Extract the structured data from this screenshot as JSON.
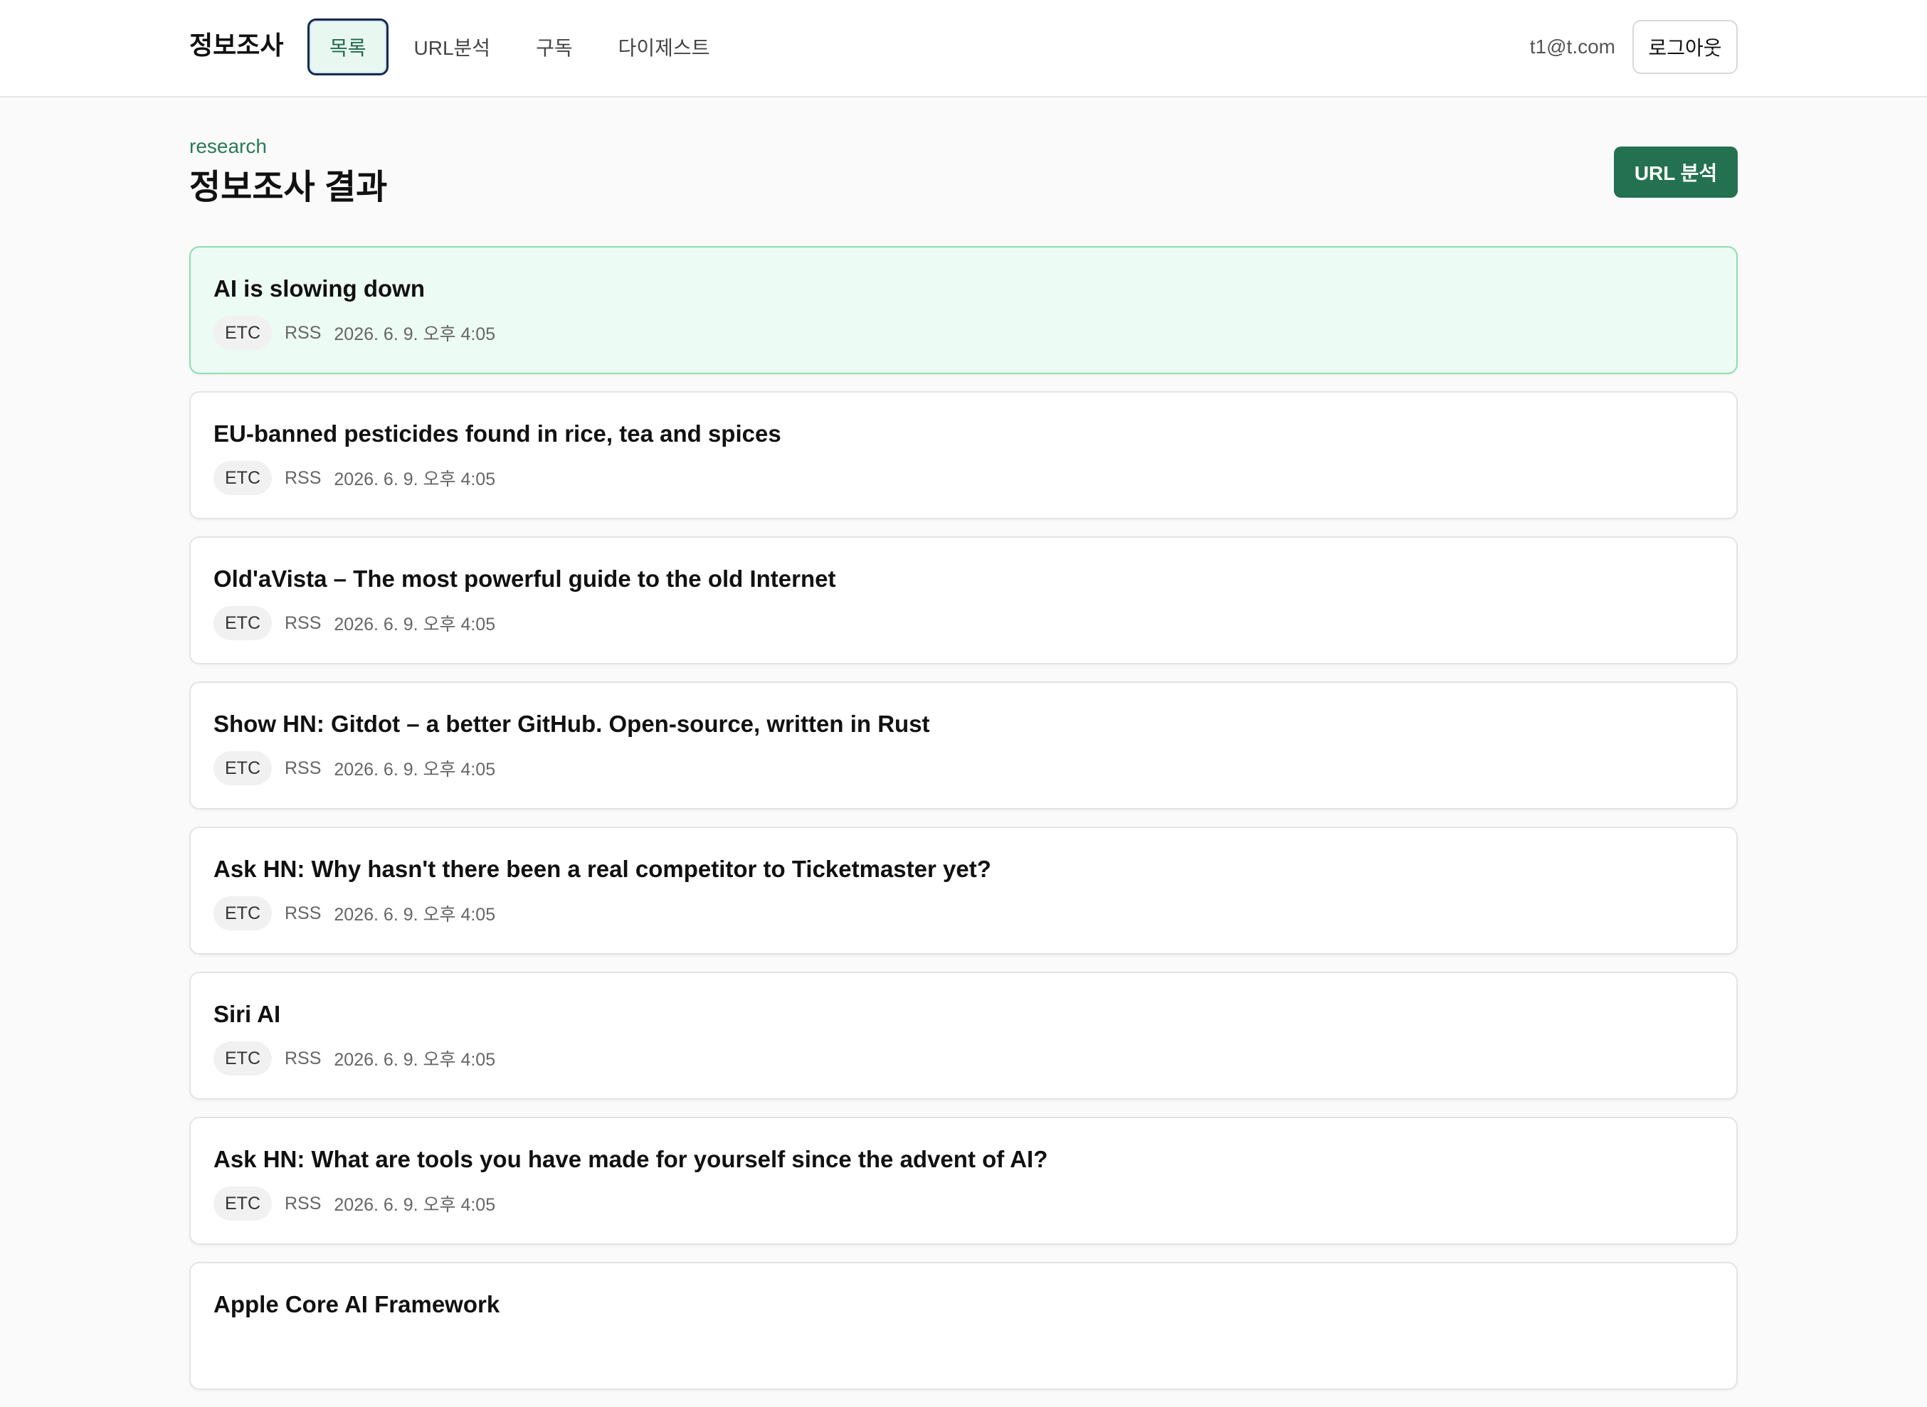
{
  "header": {
    "brand": "정보조사",
    "nav": [
      {
        "label": "목록",
        "active": true
      },
      {
        "label": "URL분석",
        "active": false
      },
      {
        "label": "구독",
        "active": false
      },
      {
        "label": "다이제스트",
        "active": false
      }
    ],
    "user_email": "t1@t.com",
    "logout_label": "로그아웃"
  },
  "page": {
    "eyebrow": "research",
    "title": "정보조사 결과",
    "action_label": "URL 분석"
  },
  "items": [
    {
      "title": "AI is slowing down",
      "category": "ETC",
      "source": "RSS",
      "date": "2026. 6. 9. 오후 4:05",
      "highlighted": true
    },
    {
      "title": "EU-banned pesticides found in rice, tea and spices",
      "category": "ETC",
      "source": "RSS",
      "date": "2026. 6. 9. 오후 4:05"
    },
    {
      "title": "Old'aVista – The most powerful guide to the old Internet",
      "category": "ETC",
      "source": "RSS",
      "date": "2026. 6. 9. 오후 4:05"
    },
    {
      "title": "Show HN: Gitdot – a better GitHub. Open-source, written in Rust",
      "category": "ETC",
      "source": "RSS",
      "date": "2026. 6. 9. 오후 4:05"
    },
    {
      "title": "Ask HN: Why hasn't there been a real competitor to Ticketmaster yet?",
      "category": "ETC",
      "source": "RSS",
      "date": "2026. 6. 9. 오후 4:05"
    },
    {
      "title": "Siri AI",
      "category": "ETC",
      "source": "RSS",
      "date": "2026. 6. 9. 오후 4:05"
    },
    {
      "title": "Ask HN: What are tools you have made for yourself since the advent of AI?",
      "category": "ETC",
      "source": "RSS",
      "date": "2026. 6. 9. 오후 4:05"
    },
    {
      "title": "Apple Core AI Framework",
      "category": "",
      "source": "",
      "date": ""
    }
  ],
  "colors": {
    "accent": "#237150",
    "highlight_bg": "#ecfbf3",
    "highlight_border": "#8fdcb3"
  }
}
